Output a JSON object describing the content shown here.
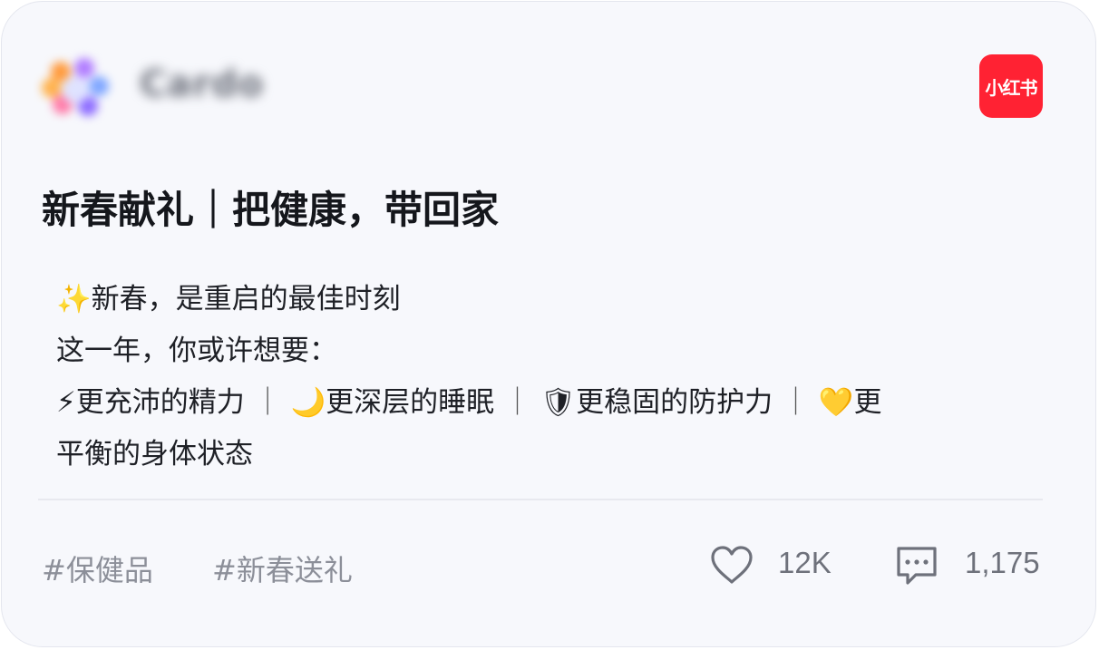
{
  "header": {
    "brand_name": "Cardo",
    "platform_label": "小红书"
  },
  "post": {
    "title": "新春献礼｜把健康，带回家",
    "lines": {
      "line1": "✨新春，是重启的最佳时刻",
      "line2": "这一年，你或许想要：",
      "line3": {
        "item1": "⚡更充沛的精力",
        "sep1": "｜ ",
        "item2": "🌙更深层的睡眠",
        "sep2": "｜ ",
        "item3": "🛡更稳固的防护力",
        "sep3": "｜ ",
        "item4_start": "💛更"
      },
      "line4": "平衡的身体状态"
    }
  },
  "footer": {
    "tags": [
      "#保健品",
      "#新春送礼"
    ],
    "likes": "12K",
    "comments": "1,175",
    "icons": {
      "likes": "heart-icon",
      "comments": "comment-icon"
    }
  },
  "colors": {
    "card_background": "#f7f8fc",
    "badge": "#ff2233",
    "title_text": "#15171c",
    "muted_text": "#8c8f99"
  }
}
